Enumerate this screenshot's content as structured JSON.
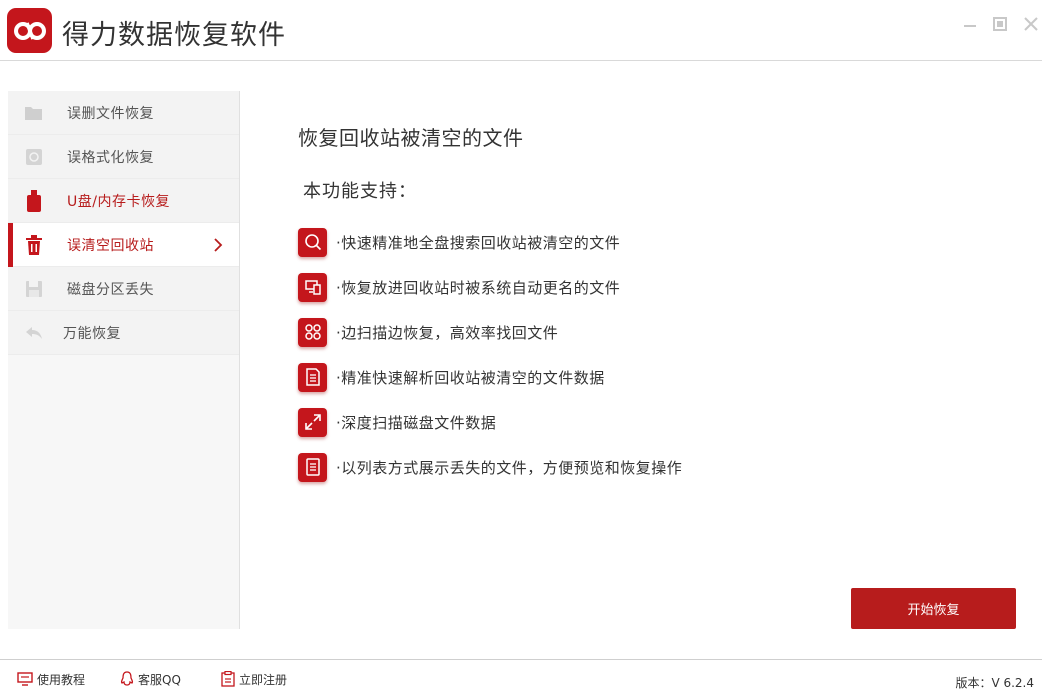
{
  "app": {
    "title": "得力数据恢复软件",
    "accent": "#c4161c"
  },
  "sidebar": {
    "items": [
      {
        "label": "误删文件恢复",
        "icon": "folder-icon"
      },
      {
        "label": "误格式化恢复",
        "icon": "disk-format-icon"
      },
      {
        "label": "U盘/内存卡恢复",
        "icon": "usb-icon"
      },
      {
        "label": "误清空回收站",
        "icon": "trash-icon",
        "active": true
      },
      {
        "label": "磁盘分区丢失",
        "icon": "floppy-icon"
      },
      {
        "label": "万能恢复",
        "icon": "undo-icon"
      }
    ]
  },
  "main": {
    "title": "恢复回收站被清空的文件",
    "subtitle": "本功能支持：",
    "features": [
      {
        "text": "·快速精准地全盘搜索回收站被清空的文件",
        "icon": "search-icon"
      },
      {
        "text": "·恢复放进回收站时被系统自动更名的文件",
        "icon": "devices-icon"
      },
      {
        "text": "·边扫描边恢复，高效率找回文件",
        "icon": "command-icon"
      },
      {
        "text": "·精准快速解析回收站被清空的文件数据",
        "icon": "list-doc-icon"
      },
      {
        "text": "·深度扫描磁盘文件数据",
        "icon": "expand-icon"
      },
      {
        "text": "·以列表方式展示丢失的文件，方便预览和恢复操作",
        "icon": "document-icon"
      }
    ],
    "start_button": "开始恢复"
  },
  "footer": {
    "tutorial": "使用教程",
    "support_qq": "客服QQ",
    "register": "立即注册",
    "version": "版本：V 6.2.4"
  }
}
